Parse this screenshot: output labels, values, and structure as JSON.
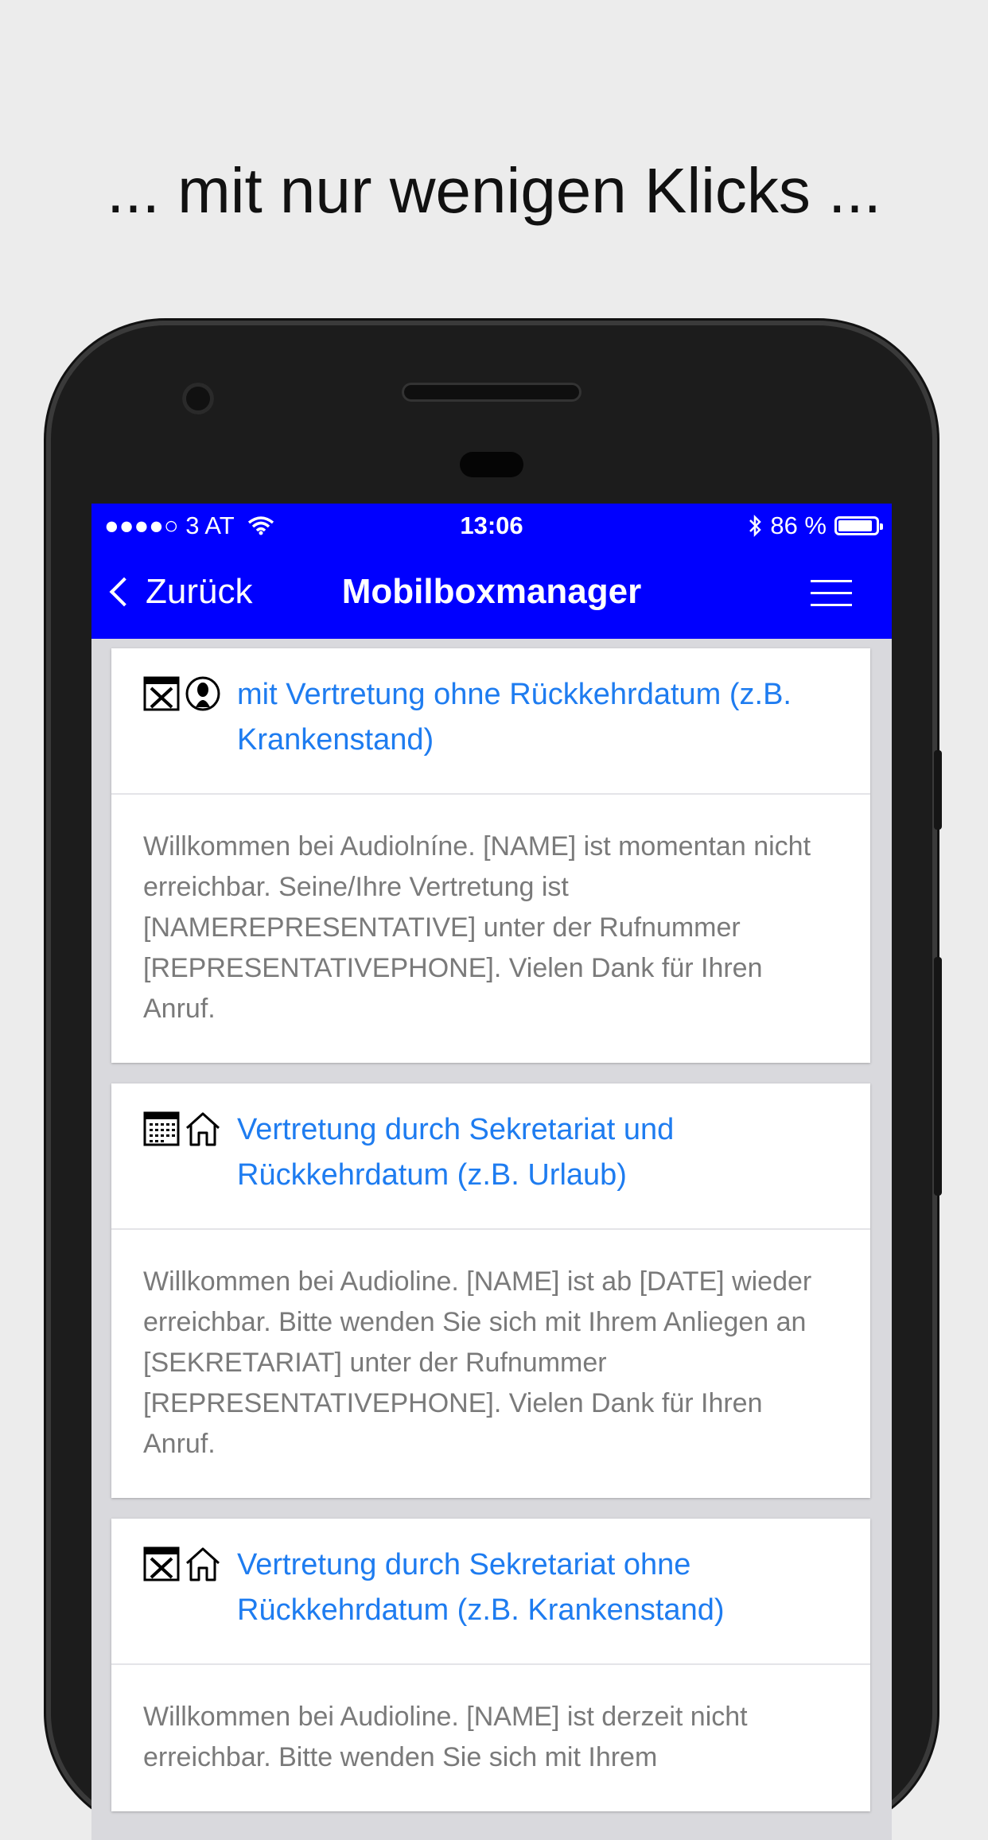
{
  "headline": "... mit nur wenigen Klicks ...",
  "status": {
    "carrier": "●●●●○ 3 AT",
    "time": "13:06",
    "battery": "86 %"
  },
  "nav": {
    "back_label": "Zurück",
    "title": "Mobilboxmanager"
  },
  "cards": [
    {
      "title": "mit Vertretung ohne Rückkehrdatum (z.B. Krankenstand)",
      "icons": [
        "no-calendar-icon",
        "person-icon"
      ],
      "text": "Willkommen bei Audiolníne. [NAME] ist momentan nicht erreichbar. Seine/Ihre Vertretung ist [NAMEREPRESENTATIVE] unter der Rufnummer [REPRESENTATIVEPHONE]. Vielen Dank für Ihren Anruf."
    },
    {
      "title": "Vertretung durch Sekretariat und Rückkehrdatum (z.B. Urlaub)",
      "icons": [
        "calendar-icon",
        "house-icon"
      ],
      "text": "Willkommen bei Audioline. [NAME] ist ab [DATE] wieder erreichbar. Bitte wenden Sie sich mit Ihrem Anliegen an [SEKRETARIAT] unter der Rufnummer [REPRESENTATIVEPHONE]. Vielen Dank für Ihren Anruf."
    },
    {
      "title": "Vertretung durch Sekretariat ohne Rückkehrdatum (z.B. Krankenstand)",
      "icons": [
        "no-calendar-icon",
        "house-icon"
      ],
      "text": "Willkommen bei Audioline. [NAME] ist derzeit nicht erreichbar. Bitte wenden Sie sich mit Ihrem"
    }
  ],
  "colors": {
    "nav_bar": "#0000ff",
    "link": "#1e7cf0",
    "body_text": "#7a7a7a",
    "background": "#ececec"
  }
}
